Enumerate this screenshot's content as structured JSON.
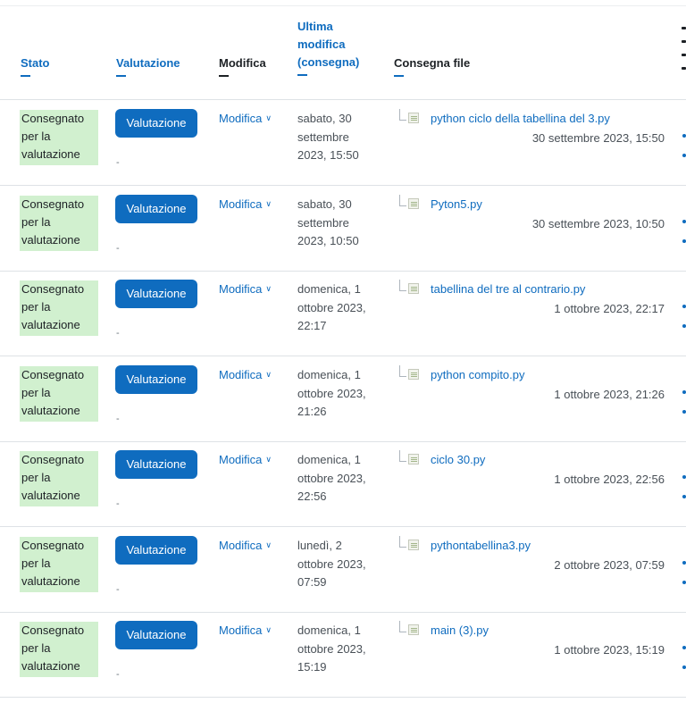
{
  "header": {
    "stato": "Stato",
    "valutazione": "Valutazione",
    "modifica": "Modifica",
    "ultima_modifica": [
      "Ultima",
      "modifica",
      "(consegna)"
    ],
    "consegna_file": "Consegna file"
  },
  "rows": [
    {
      "status": [
        "Consegnato",
        "per la",
        "valutazione"
      ],
      "grade_button": "Valutazione",
      "grade_value": "-",
      "edit_label": "Modifica",
      "last_modified": [
        "sabato, 30",
        "settembre",
        "2023, 15:50"
      ],
      "file_name": "python ciclo della tabellina del 3.py",
      "file_date": "30 settembre 2023, 15:50"
    },
    {
      "status": [
        "Consegnato",
        "per la",
        "valutazione"
      ],
      "grade_button": "Valutazione",
      "grade_value": "-",
      "edit_label": "Modifica",
      "last_modified": [
        "sabato, 30",
        "settembre",
        "2023, 10:50"
      ],
      "file_name": "Pyton5.py",
      "file_date": "30 settembre 2023, 10:50"
    },
    {
      "status": [
        "Consegnato",
        "per la",
        "valutazione"
      ],
      "grade_button": "Valutazione",
      "grade_value": "-",
      "edit_label": "Modifica",
      "last_modified": [
        "domenica, 1",
        "ottobre 2023,",
        "22:17"
      ],
      "file_name": "tabellina del tre al contrario.py",
      "file_date": "1 ottobre 2023, 22:17"
    },
    {
      "status": [
        "Consegnato",
        "per la",
        "valutazione"
      ],
      "grade_button": "Valutazione",
      "grade_value": "-",
      "edit_label": "Modifica",
      "last_modified": [
        "domenica, 1",
        "ottobre 2023,",
        "21:26"
      ],
      "file_name": "python compito.py",
      "file_date": "1 ottobre 2023, 21:26"
    },
    {
      "status": [
        "Consegnato",
        "per la",
        "valutazione"
      ],
      "grade_button": "Valutazione",
      "grade_value": "-",
      "edit_label": "Modifica",
      "last_modified": [
        "domenica, 1",
        "ottobre 2023,",
        "22:56"
      ],
      "file_name": "ciclo 30.py",
      "file_date": "1 ottobre 2023, 22:56"
    },
    {
      "status": [
        "Consegnato",
        "per la",
        "valutazione"
      ],
      "grade_button": "Valutazione",
      "grade_value": "-",
      "edit_label": "Modifica",
      "last_modified": [
        "lunedì, 2",
        "ottobre 2023,",
        "07:59"
      ],
      "file_name": "pythontabellina3.py",
      "file_date": "2 ottobre 2023, 07:59"
    },
    {
      "status": [
        "Consegnato",
        "per la",
        "valutazione"
      ],
      "grade_button": "Valutazione",
      "grade_value": "-",
      "edit_label": "Modifica",
      "last_modified": [
        "domenica, 1",
        "ottobre 2023,",
        "15:19"
      ],
      "file_name": "main (3).py",
      "file_date": "1 ottobre 2023, 15:19"
    }
  ],
  "icons": {
    "sort": "sort-bar-icon",
    "chevron": "chevron-down-icon",
    "file": "file-tree-icon"
  },
  "colors": {
    "link": "#0f6cbf",
    "status_bg": "#d1f0cf",
    "button_bg": "#0f6cbf"
  }
}
